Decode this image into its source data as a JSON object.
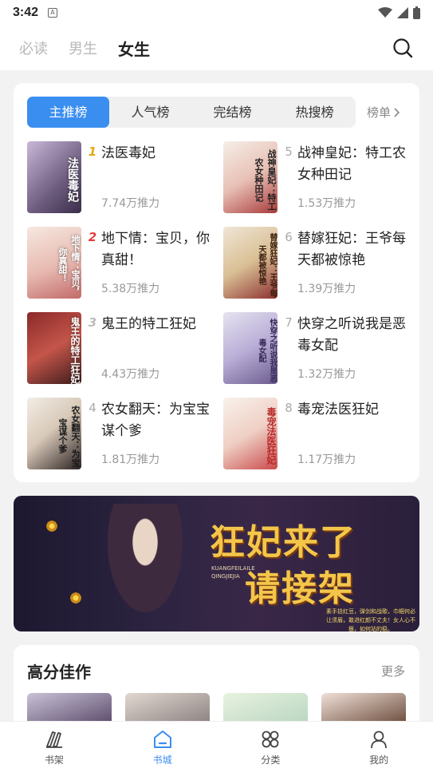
{
  "status": {
    "time": "3:42"
  },
  "header": {
    "tabs": [
      {
        "label": "必读",
        "active": false
      },
      {
        "label": "男生",
        "active": false
      },
      {
        "label": "女生",
        "active": true
      }
    ],
    "search_icon": "search-icon"
  },
  "ranking": {
    "tabs": [
      "主推榜",
      "人气榜",
      "完结榜",
      "热搜榜"
    ],
    "active_tab": "主推榜",
    "more_label": "榜单",
    "books": [
      {
        "rank": "1",
        "title": "法医毒妃",
        "heat": "7.74万推力"
      },
      {
        "rank": "2",
        "title": "地下情：宝贝，你真甜！",
        "heat": "5.38万推力"
      },
      {
        "rank": "3",
        "title": "鬼王的特工狂妃",
        "heat": "4.43万推力"
      },
      {
        "rank": "4",
        "title": "农女翻天：为宝宝谋个爹",
        "heat": "1.81万推力"
      },
      {
        "rank": "5",
        "title": "战神皇妃：特工农女种田记",
        "heat": "1.53万推力"
      },
      {
        "rank": "6",
        "title": "替嫁狂妃：王爷每天都被惊艳",
        "heat": "1.39万推力"
      },
      {
        "rank": "7",
        "title": "快穿之听说我是恶毒女配",
        "heat": "1.32万推力"
      },
      {
        "rank": "8",
        "title": "毒宠法医狂妃",
        "heat": "1.17万推力"
      }
    ]
  },
  "banner": {
    "line1": "狂妃来了",
    "line2": "请接架",
    "pinyin": "KUANGFEILAILE QINGJIEJIA",
    "slogan": "素手捻红豆，弹剑和战歌，巾帼何必让须眉，敢进红颜不丈夫！女人心不狠，如何站的稳。"
  },
  "high_score": {
    "title": "高分佳作",
    "more_label": "更多"
  },
  "bottom_nav": [
    {
      "label": "书架",
      "icon": "bookshelf-icon",
      "active": false
    },
    {
      "label": "书城",
      "icon": "bookstore-icon",
      "active": true
    },
    {
      "label": "分类",
      "icon": "category-icon",
      "active": false
    },
    {
      "label": "我的",
      "icon": "profile-icon",
      "active": false
    }
  ],
  "colors": {
    "accent": "#3a8ef0",
    "rank1": "#e6a814",
    "rank2": "#e63b3b"
  }
}
